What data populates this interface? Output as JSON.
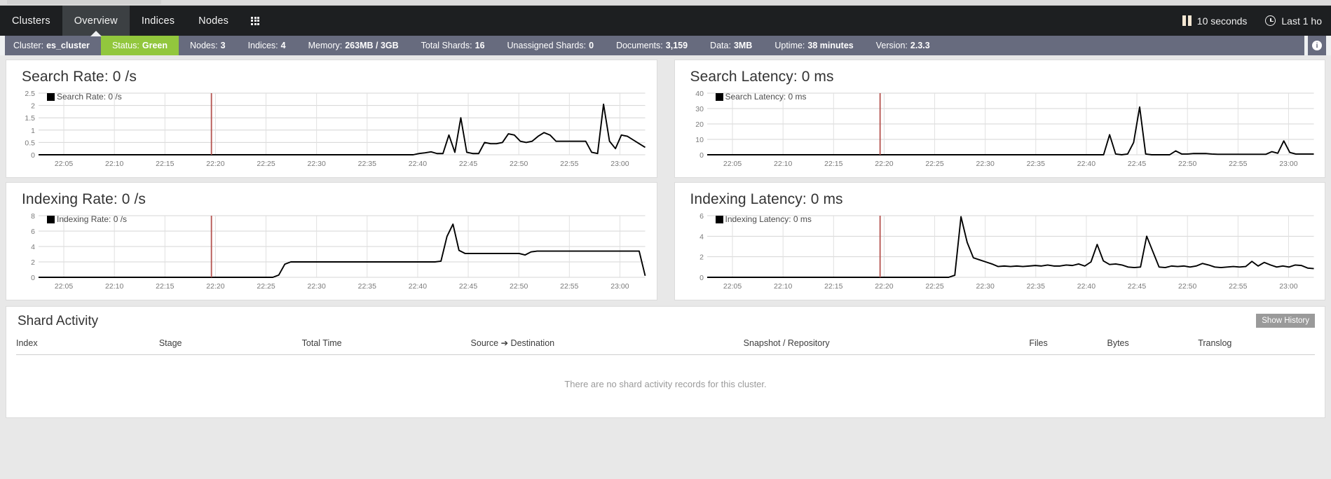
{
  "nav": {
    "items": [
      {
        "label": "Clusters",
        "active": false
      },
      {
        "label": "Overview",
        "active": true
      },
      {
        "label": "Indices",
        "active": false
      },
      {
        "label": "Nodes",
        "active": false
      }
    ],
    "grid_icon": "grid-icon",
    "refresh_interval": "10 seconds",
    "time_range": "Last 1 ho",
    "pause_icon": "pause-icon",
    "clock_icon": "clock-icon"
  },
  "statusbar": {
    "cells": [
      {
        "label": "Cluster:",
        "value": "es_cluster",
        "style": "plain"
      },
      {
        "label": "Status:",
        "value": "Green",
        "style": "green"
      },
      {
        "label": "Nodes:",
        "value": "3",
        "style": "plain"
      },
      {
        "label": "Indices:",
        "value": "4",
        "style": "plain"
      },
      {
        "label": "Memory:",
        "value": "263MB / 3GB",
        "style": "plain"
      },
      {
        "label": "Total Shards:",
        "value": "16",
        "style": "plain"
      },
      {
        "label": "Unassigned Shards:",
        "value": "0",
        "style": "plain"
      },
      {
        "label": "Documents:",
        "value": "3,159",
        "style": "plain"
      },
      {
        "label": "Data:",
        "value": "3MB",
        "style": "plain"
      },
      {
        "label": "Uptime:",
        "value": "38 minutes",
        "style": "plain"
      },
      {
        "label": "Version:",
        "value": "2.3.3",
        "style": "plain"
      }
    ],
    "info_icon": "info-icon",
    "info_glyph": "i",
    "green_color": "#92c73d",
    "bar_color": "#676b7e"
  },
  "chart_data": [
    {
      "type": "line",
      "panel_id": "search-rate",
      "title": "Search Rate: 0 /s",
      "legend": [
        "Search Rate: 0 /s"
      ],
      "xlabel": "",
      "ylabel": "",
      "ylim": [
        0,
        2.5
      ],
      "yticks": [
        "0",
        "0.5",
        "1",
        "1.5",
        "2",
        "2.5"
      ],
      "xticks": [
        "22:05",
        "22:10",
        "22:15",
        "22:20",
        "22:25",
        "22:30",
        "22:35",
        "22:40",
        "22:45",
        "22:50",
        "22:55",
        "23:00"
      ],
      "marker_line_time": "22:21",
      "marker_color": "#b5534f",
      "line_color": "#000000",
      "grid": true,
      "values": [
        0,
        0,
        0,
        0,
        0,
        0,
        0,
        0,
        0,
        0,
        0,
        0,
        0,
        0,
        0,
        0,
        0,
        0,
        0,
        0,
        0,
        0,
        0,
        0,
        0,
        0,
        0,
        0,
        0,
        0,
        0,
        0,
        0,
        0,
        0,
        0,
        0,
        0,
        0,
        0,
        0,
        0,
        0,
        0,
        0,
        0,
        0,
        0,
        0,
        0,
        0,
        0,
        0,
        0,
        0,
        0,
        0,
        0,
        0,
        0,
        0,
        0,
        0,
        0,
        0.05,
        0.08,
        0.12,
        0.05,
        0.05,
        0.8,
        0.1,
        1.5,
        0.1,
        0.05,
        0.05,
        0.5,
        0.45,
        0.45,
        0.5,
        0.85,
        0.8,
        0.55,
        0.5,
        0.55,
        0.75,
        0.9,
        0.8,
        0.55,
        0.55,
        0.55,
        0.55,
        0.55,
        0.55,
        0.1,
        0.05,
        2.05,
        0.55,
        0.25,
        0.8,
        0.75,
        0.6,
        0.45,
        0.3
      ]
    },
    {
      "type": "line",
      "panel_id": "search-latency",
      "title": "Search Latency: 0 ms",
      "legend": [
        "Search Latency: 0 ms"
      ],
      "xlabel": "",
      "ylabel": "",
      "ylim": [
        0,
        40
      ],
      "yticks": [
        "0",
        "10",
        "20",
        "30",
        "40"
      ],
      "xticks": [
        "22:05",
        "22:10",
        "22:15",
        "22:20",
        "22:25",
        "22:30",
        "22:35",
        "22:40",
        "22:45",
        "22:50",
        "22:55",
        "23:00"
      ],
      "marker_line_time": "22:21",
      "marker_color": "#b5534f",
      "line_color": "#000000",
      "grid": true,
      "values": [
        0,
        0,
        0,
        0,
        0,
        0,
        0,
        0,
        0,
        0,
        0,
        0,
        0,
        0,
        0,
        0,
        0,
        0,
        0,
        0,
        0,
        0,
        0,
        0,
        0,
        0,
        0,
        0,
        0,
        0,
        0,
        0,
        0,
        0,
        0,
        0,
        0,
        0,
        0,
        0,
        0,
        0,
        0,
        0,
        0,
        0,
        0,
        0,
        0,
        0,
        0,
        0,
        0,
        0,
        0,
        0,
        0,
        0,
        0,
        0,
        0,
        0,
        0,
        0,
        0,
        0,
        0,
        13,
        0.5,
        0,
        0.5,
        8,
        31,
        0.5,
        0,
        0,
        0,
        0,
        2.5,
        0.5,
        0.5,
        0.8,
        0.8,
        0.8,
        0.5,
        0.3,
        0.3,
        0.3,
        0.3,
        0.3,
        0.3,
        0.3,
        0.3,
        0.3,
        2,
        1,
        9,
        1.5,
        0.5,
        0.5,
        0.5,
        0.5
      ]
    },
    {
      "type": "line",
      "panel_id": "indexing-rate",
      "title": "Indexing Rate: 0 /s",
      "legend": [
        "Indexing Rate: 0 /s"
      ],
      "xlabel": "",
      "ylabel": "",
      "ylim": [
        0,
        8
      ],
      "yticks": [
        "0",
        "2",
        "4",
        "6",
        "8"
      ],
      "xticks": [
        "22:05",
        "22:10",
        "22:15",
        "22:20",
        "22:25",
        "22:30",
        "22:35",
        "22:40",
        "22:45",
        "22:50",
        "22:55",
        "23:00"
      ],
      "marker_line_time": "22:21",
      "marker_color": "#b5534f",
      "line_color": "#000000",
      "grid": true,
      "values": [
        0,
        0,
        0,
        0,
        0,
        0,
        0,
        0,
        0,
        0,
        0,
        0,
        0,
        0,
        0,
        0,
        0,
        0,
        0,
        0,
        0,
        0,
        0,
        0,
        0,
        0,
        0,
        0,
        0,
        0,
        0,
        0,
        0,
        0,
        0,
        0,
        0,
        0,
        0,
        0,
        0.3,
        1.7,
        2,
        2,
        2,
        2,
        2,
        2,
        2,
        2,
        2,
        2,
        2,
        2,
        2,
        2,
        2,
        2,
        2,
        2,
        2,
        2,
        2,
        2,
        2,
        2,
        2,
        2.1,
        5.3,
        6.9,
        3.5,
        3.1,
        3.1,
        3.1,
        3.1,
        3.1,
        3.1,
        3.1,
        3.1,
        3.1,
        3.1,
        2.9,
        3.3,
        3.4,
        3.4,
        3.4,
        3.4,
        3.4,
        3.4,
        3.4,
        3.4,
        3.4,
        3.4,
        3.4,
        3.4,
        3.4,
        3.4,
        3.4,
        3.4,
        3.4,
        3.4,
        0.2
      ]
    },
    {
      "type": "line",
      "panel_id": "indexing-latency",
      "title": "Indexing Latency: 0 ms",
      "legend": [
        "Indexing Latency: 0 ms"
      ],
      "xlabel": "",
      "ylabel": "",
      "ylim": [
        0,
        6
      ],
      "yticks": [
        "0",
        "2",
        "4",
        "6"
      ],
      "xticks": [
        "22:05",
        "22:10",
        "22:15",
        "22:20",
        "22:25",
        "22:30",
        "22:35",
        "22:40",
        "22:45",
        "22:50",
        "22:55",
        "23:00"
      ],
      "marker_line_time": "22:21",
      "marker_color": "#b5534f",
      "line_color": "#000000",
      "grid": true,
      "values": [
        0,
        0,
        0,
        0,
        0,
        0,
        0,
        0,
        0,
        0,
        0,
        0,
        0,
        0,
        0,
        0,
        0,
        0,
        0,
        0,
        0,
        0,
        0,
        0,
        0,
        0,
        0,
        0,
        0,
        0,
        0,
        0,
        0,
        0,
        0,
        0,
        0,
        0,
        0,
        0,
        0.2,
        5.9,
        3.4,
        1.9,
        1.7,
        1.5,
        1.3,
        1.05,
        1.1,
        1.05,
        1.1,
        1.05,
        1.1,
        1.15,
        1.1,
        1.2,
        1.1,
        1.1,
        1.2,
        1.15,
        1.3,
        1.1,
        1.5,
        3.2,
        1.6,
        1.25,
        1.3,
        1.2,
        1.0,
        0.95,
        1.0,
        4.0,
        2.5,
        1.0,
        0.95,
        1.1,
        1.05,
        1.1,
        1.0,
        1.1,
        1.35,
        1.2,
        1.0,
        0.95,
        1.0,
        1.05,
        1.0,
        1.05,
        1.55,
        1.1,
        1.45,
        1.2,
        1.0,
        1.1,
        1.0,
        1.2,
        1.15,
        0.9,
        0.85
      ]
    }
  ],
  "shard_activity": {
    "title": "Shard Activity",
    "show_history_label": "Show History",
    "columns": [
      "Index",
      "Stage",
      "Total Time",
      "Source ➔ Destination",
      "Snapshot / Repository",
      "Files",
      "Bytes",
      "Translog"
    ],
    "empty_message": "There are no shard activity records for this cluster."
  }
}
